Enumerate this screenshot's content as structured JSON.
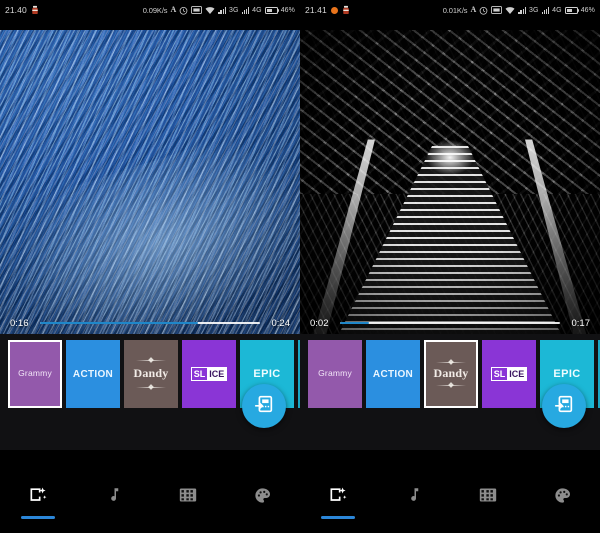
{
  "panels": [
    {
      "id": "left",
      "status": {
        "time": "21.40",
        "icons_left": [
          "app-notification-icon"
        ],
        "net_speed": "0.09K/s",
        "icons_right": [
          "alarm-letter-icon",
          "alarm-clock-icon",
          "screenshot-icon",
          "wifi-icon"
        ],
        "sim1": "3G",
        "sim2": "4G",
        "battery": "46%"
      },
      "player": {
        "current_time": "0:16",
        "total_time": "0:24",
        "progress_percent": 72,
        "clip_description": "blue-water-texture"
      },
      "filters": [
        {
          "name": "Grammy",
          "style": "grammy",
          "selected": true
        },
        {
          "name": "ACTION",
          "style": "action",
          "selected": false
        },
        {
          "name": "Dandy",
          "style": "dandy",
          "selected": false
        },
        {
          "name": "SLICE",
          "style": "slice",
          "selected": false
        },
        {
          "name": "EPIC",
          "style": "epic",
          "selected": false
        },
        {
          "name": "",
          "style": "extra",
          "selected": false
        }
      ],
      "fab": {
        "icon": "export-video-icon",
        "color": "#27a9e1"
      },
      "toolbar": [
        {
          "icon": "effects-icon",
          "label": "Effects",
          "active": true
        },
        {
          "icon": "music-note-icon",
          "label": "Music",
          "active": false
        },
        {
          "icon": "film-strip-icon",
          "label": "Clips",
          "active": false
        },
        {
          "icon": "palette-icon",
          "label": "Filters",
          "active": false
        }
      ]
    },
    {
      "id": "right",
      "status": {
        "time": "21.41",
        "icons_left": [
          "orange-circle-icon",
          "app-notification-icon"
        ],
        "net_speed": "0.01K/s",
        "icons_right": [
          "alarm-letter-icon",
          "alarm-clock-icon",
          "screenshot-icon",
          "wifi-icon"
        ],
        "sim1": "3G",
        "sim2": "4G",
        "battery": "46%"
      },
      "player": {
        "current_time": "0:02",
        "total_time": "0:17",
        "progress_percent": 13,
        "clip_description": "monochrome-escalator"
      },
      "filters": [
        {
          "name": "Grammy",
          "style": "grammy",
          "selected": false
        },
        {
          "name": "ACTION",
          "style": "action",
          "selected": false
        },
        {
          "name": "Dandy",
          "style": "dandy",
          "selected": true
        },
        {
          "name": "SLICE",
          "style": "slice",
          "selected": false
        },
        {
          "name": "EPIC",
          "style": "epic",
          "selected": false
        },
        {
          "name": "",
          "style": "extra",
          "selected": false
        }
      ],
      "fab": {
        "icon": "export-video-icon",
        "color": "#27a9e1"
      },
      "toolbar": [
        {
          "icon": "effects-icon",
          "label": "Effects",
          "active": true
        },
        {
          "icon": "music-note-icon",
          "label": "Music",
          "active": false
        },
        {
          "icon": "film-strip-icon",
          "label": "Clips",
          "active": false
        },
        {
          "icon": "palette-icon",
          "label": "Filters",
          "active": false
        }
      ]
    }
  ],
  "slice_label": {
    "part1": "SL",
    "part2": "ICE"
  },
  "colors": {
    "accent": "#27a9e1",
    "tab_indicator": "#2b86d8",
    "seek_fill": "#1f87c9",
    "background": "#000000",
    "filter_tray": "#111113"
  }
}
